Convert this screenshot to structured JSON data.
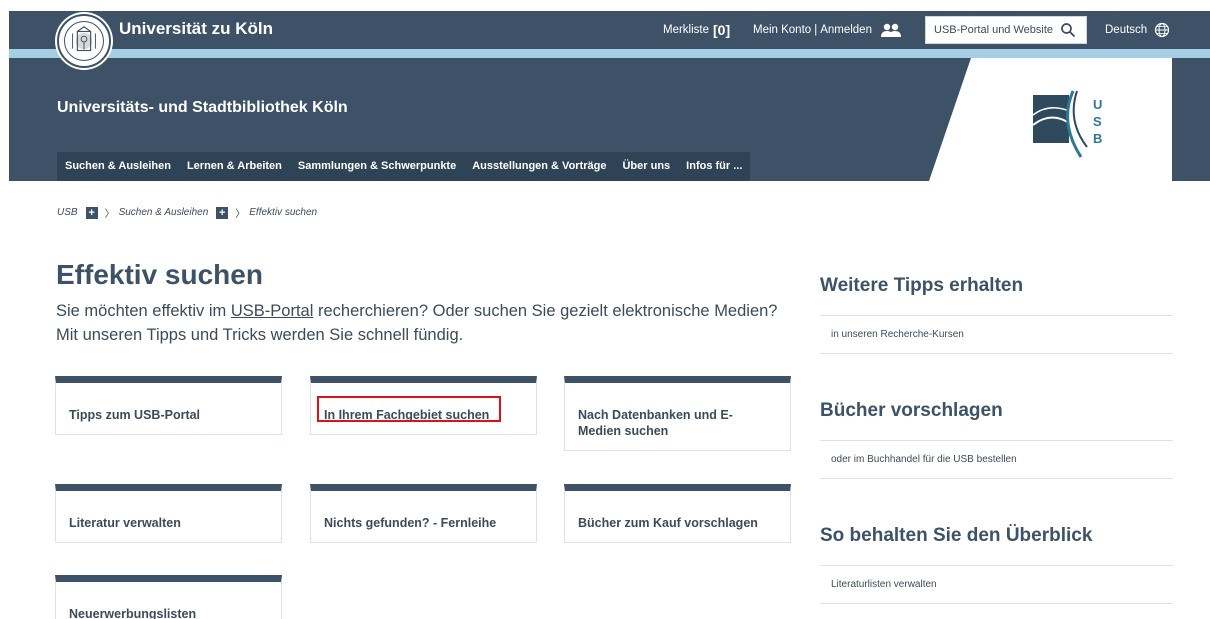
{
  "header": {
    "university_name": "Universität zu Köln",
    "merkliste_label": "Merkliste",
    "merkliste_count": "[0]",
    "konto_label": "Mein Konto",
    "konto_separator": "|",
    "login_label": "Anmelden",
    "search_placeholder": "USB-Portal und Website",
    "language_label": "Deutsch",
    "library_name": "Universitäts- und Stadtbibliothek Köln",
    "nav": [
      "Suchen & Ausleihen",
      "Lernen & Arbeiten",
      "Sammlungen & Schwerpunkte",
      "Ausstellungen & Vorträge",
      "Über uns",
      "Infos für ..."
    ],
    "logo_letters": [
      "U",
      "S",
      "B"
    ]
  },
  "breadcrumb": {
    "items": [
      "USB",
      "Suchen & Ausleihen",
      "Effektiv suchen"
    ],
    "plus": "+",
    "separator": "〉"
  },
  "main": {
    "title": "Effektiv suchen",
    "intro_before": "Sie möchten effektiv im ",
    "intro_link": "USB-Portal",
    "intro_after": " recherchieren? Oder suchen Sie gezielt elektronische Medien? Mit unseren Tipps und Tricks werden Sie schnell fündig.",
    "cards": [
      "Tipps zum USB-Portal",
      "In Ihrem Fachgebiet suchen",
      "Nach Datenbanken und E-Medien suchen",
      "Literatur verwalten",
      "Nichts gefunden? - Fernleihe",
      "Bücher zum Kauf vorschlagen",
      "Neuerwerbungslisten"
    ]
  },
  "sidebar": {
    "sections": [
      {
        "heading": "Weitere Tipps erhalten",
        "link": "in unseren Recherche-Kursen"
      },
      {
        "heading": "Bücher vorschlagen",
        "link": "oder im Buchhandel für die USB bestellen"
      },
      {
        "heading": "So behalten Sie den Überblick",
        "link": "Literaturlisten verwalten"
      }
    ]
  },
  "colors": {
    "header_blue": "#3d5266",
    "light_stripe": "#a6cee5",
    "highlight_red": "#e0101a"
  },
  "icons": [
    "university-seal-icon",
    "people-icon",
    "search-icon",
    "globe-icon",
    "usb-logo-icon",
    "plus-icon"
  ]
}
